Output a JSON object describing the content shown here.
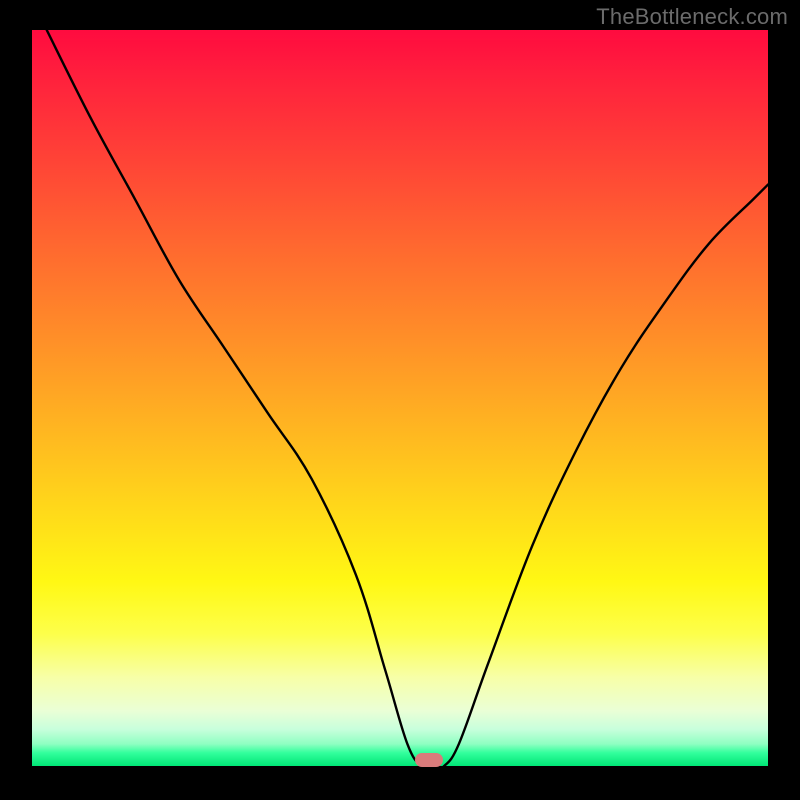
{
  "watermark": "TheBottleneck.com",
  "colors": {
    "page_bg": "#000000",
    "curve": "#000000",
    "marker": "#d97b7b",
    "watermark_text": "#6b6b6b"
  },
  "chart_data": {
    "type": "line",
    "title": "",
    "xlabel": "",
    "ylabel": "",
    "xlim": [
      0,
      100
    ],
    "ylim": [
      0,
      100
    ],
    "grid": false,
    "legend": false,
    "series": [
      {
        "name": "bottleneck_curve",
        "x": [
          2,
          8,
          14,
          20,
          26,
          32,
          38,
          44,
          48,
          51,
          53,
          55,
          56,
          58,
          62,
          68,
          74,
          80,
          86,
          92,
          98,
          100
        ],
        "y": [
          100,
          88,
          77,
          66,
          57,
          48,
          39,
          26,
          13,
          3,
          0,
          0,
          0,
          3,
          14,
          30,
          43,
          54,
          63,
          71,
          77,
          79
        ]
      }
    ],
    "annotations": [
      {
        "name": "minimum_marker",
        "x": 54,
        "y": 0.8,
        "shape": "rounded_rect",
        "color": "#d97b7b"
      }
    ],
    "background_gradient_stops": [
      {
        "pos": 0.0,
        "color": "#ff0b3f"
      },
      {
        "pos": 0.3,
        "color": "#ff6a2f"
      },
      {
        "pos": 0.65,
        "color": "#ffd81a"
      },
      {
        "pos": 0.88,
        "color": "#f7ffa8"
      },
      {
        "pos": 0.97,
        "color": "#8fffc2"
      },
      {
        "pos": 1.0,
        "color": "#00e676"
      }
    ]
  }
}
